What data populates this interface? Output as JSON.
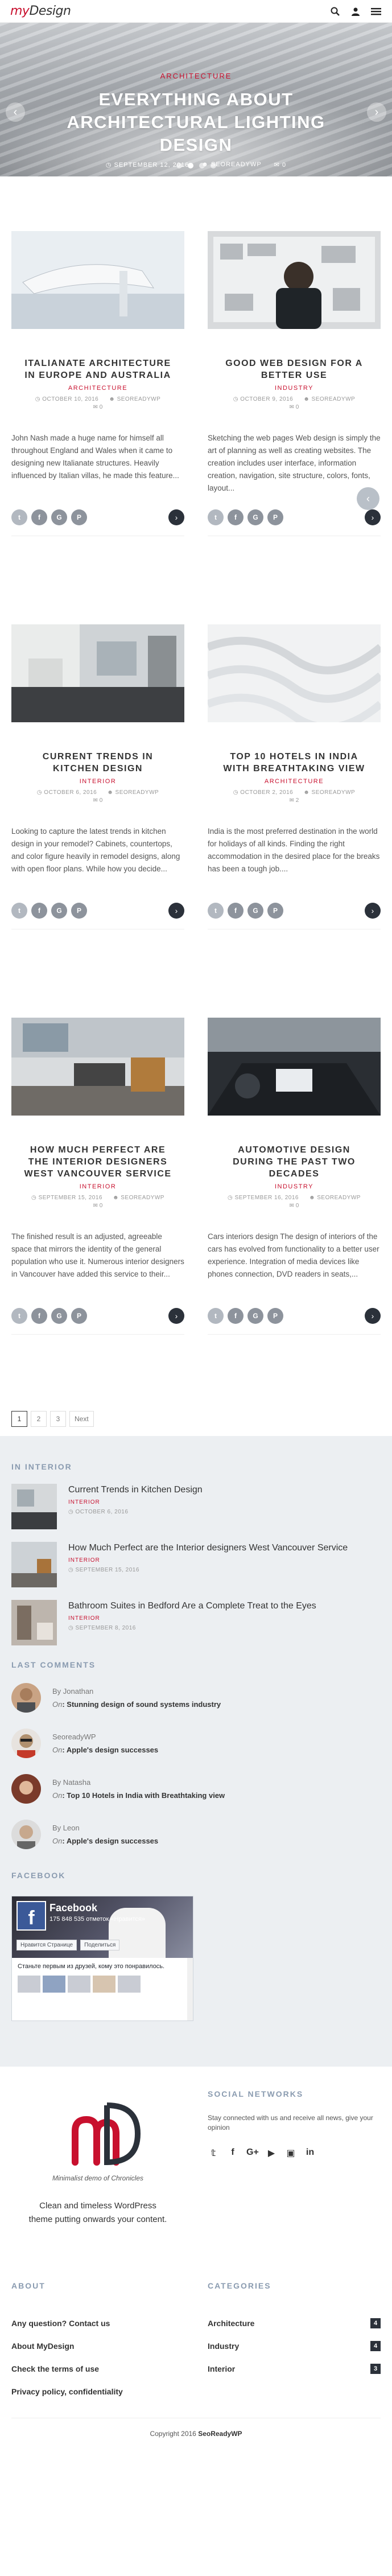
{
  "header": {
    "logo_part1": "my",
    "logo_part2": "Design",
    "icons": [
      "search-icon",
      "user-icon",
      "menu-icon"
    ]
  },
  "hero": {
    "category": "ARCHITECTURE",
    "title": "EVERYTHING ABOUT ARCHITECTURAL LIGHTING DESIGN",
    "date": "SEPTEMBER 12, 2016",
    "author": "SEOREADYWP",
    "comments": "0"
  },
  "posts": [
    {
      "title": "ITALIANATE ARCHITECTURE IN EUROPE AND AUSTRALIA",
      "category": "ARCHITECTURE",
      "date": "OCTOBER 10, 2016",
      "author": "SEOREADYWP",
      "comments": "0",
      "excerpt": "John Nash made a huge name for himself all throughout England and Wales when it came to designing new Italianate structures. Heavily influenced by Italian villas, he made this feature..."
    },
    {
      "title": "GOOD WEB DESIGN FOR A BETTER USE",
      "category": "INDUSTRY",
      "date": "OCTOBER 9, 2016",
      "author": "SEOREADYWP",
      "comments": "0",
      "excerpt": "Sketching the web pages Web design is simply the art of planning as well as creating websites. The creation includes user interface, information creation, navigation, site structure, colors, fonts, layout..."
    },
    {
      "title": "CURRENT TRENDS IN KITCHEN DESIGN",
      "category": "INTERIOR",
      "date": "OCTOBER 6, 2016",
      "author": "SEOREADYWP",
      "comments": "0",
      "excerpt": "Looking to capture the latest trends in kitchen design in your remodel? Cabinets, countertops, and color figure heavily in remodel designs, along with open floor plans. While how you decide..."
    },
    {
      "title": "TOP 10 HOTELS IN INDIA WITH BREATHTAKING VIEW",
      "category": "ARCHITECTURE",
      "date": "OCTOBER 2, 2016",
      "author": "SEOREADYWP",
      "comments": "2",
      "excerpt": "India is the most preferred destination in the world for holidays of all kinds. Finding the right accommodation in the desired place for the breaks has been a tough job...."
    },
    {
      "title": "HOW MUCH PERFECT ARE THE INTERIOR DESIGNERS WEST VANCOUVER SERVICE",
      "category": "INTERIOR",
      "date": "SEPTEMBER 15, 2016",
      "author": "SEOREADYWP",
      "comments": "0",
      "excerpt": "The finished result is an adjusted, agreeable space that mirrors the identity of the general population who use it. Numerous interior designers in Vancouver have added this service to their..."
    },
    {
      "title": "AUTOMOTIVE DESIGN DURING THE PAST TWO DECADES",
      "category": "INDUSTRY",
      "date": "SEPTEMBER 16, 2016",
      "author": "SEOREADYWP",
      "comments": "0",
      "excerpt": "Cars interiors design The design of interiors of the cars has evolved from functionality to a better user experience. Integration of media devices like phones connection, DVD readers in seats,..."
    }
  ],
  "pagination": [
    "1",
    "2",
    "3",
    "Next"
  ],
  "in_interior": {
    "title": "IN INTERIOR",
    "items": [
      {
        "title": "Current Trends in Kitchen Design",
        "category": "INTERIOR",
        "date": "OCTOBER 6, 2016"
      },
      {
        "title": "How Much Perfect are the Interior designers West Vancouver Service",
        "category": "INTERIOR",
        "date": "SEPTEMBER 15, 2016"
      },
      {
        "title": "Bathroom Suites in Bedford Are a Complete Treat to the Eyes",
        "category": "INTERIOR",
        "date": "SEPTEMBER 8, 2016"
      }
    ]
  },
  "last_comments": {
    "title": "LAST COMMENTS",
    "items": [
      {
        "by": "By Jonathan",
        "on_label": "On",
        "post": "Stunning design of sound systems industry"
      },
      {
        "by": "SeoreadyWP",
        "on_label": "On",
        "post": "Apple's design successes"
      },
      {
        "by": "By Natasha",
        "on_label": "On",
        "post": "Top 10 Hotels in India with Breathtaking view"
      },
      {
        "by": "By Leon",
        "on_label": "On",
        "post": "Apple's design successes"
      }
    ]
  },
  "facebook": {
    "title": "FACEBOOK",
    "page_name": "Facebook",
    "likes": "175 848 535 отметок «Нравится»",
    "like_btn": "Нравится Странице",
    "share_btn": "Поделиться",
    "post_text": "Станьте первым из друзей, кому это понравилось."
  },
  "footer": {
    "tagline": "Minimalist demo of Chronicles",
    "description": "Clean and timeless WordPress theme putting onwards your content.",
    "social_title": "SOCIAL NETWORKS",
    "social_text": "Stay connected with us and receive all news, give your opinion",
    "social_icons": [
      "twitter-icon",
      "facebook-icon",
      "google-plus-icon",
      "youtube-icon",
      "instagram-icon",
      "linkedin-icon"
    ],
    "about_title": "ABOUT",
    "about_links": [
      "Any question? Contact us",
      "About MyDesign",
      "Check the terms of use",
      "Privacy policy, confidentiality"
    ],
    "categories_title": "CATEGORIES",
    "categories": [
      {
        "name": "Architecture",
        "count": "4"
      },
      {
        "name": "Industry",
        "count": "4"
      },
      {
        "name": "Interior",
        "count": "3"
      }
    ],
    "copyright_text": "Copyright 2016",
    "copyright_brand": "SeoReadyWP"
  },
  "colors": {
    "accent": "#c8102e",
    "dark": "#2b313a",
    "widget_title": "#8a9bb0",
    "gray_bg": "#eceff2"
  }
}
